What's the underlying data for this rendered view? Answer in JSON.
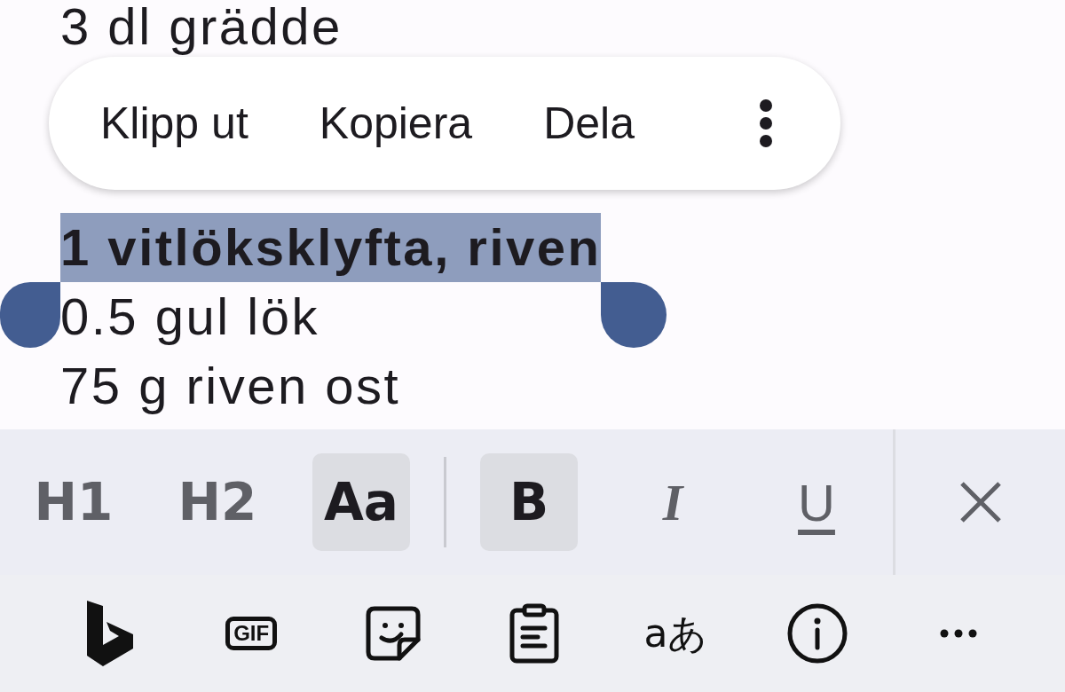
{
  "note": {
    "line_above_menu": "3 dl grädde",
    "lines": [
      {
        "text": "1 vitlöksklyfta, riven",
        "selected": true
      },
      {
        "text": "0.5 gul lök",
        "selected": false
      },
      {
        "text": "75 g riven ost",
        "selected": false
      }
    ]
  },
  "selection_menu": {
    "items": [
      "Klipp ut",
      "Kopiera",
      "Dela"
    ]
  },
  "format_toolbar": {
    "buttons": [
      {
        "kind": "h1",
        "label": "H1",
        "selected": false
      },
      {
        "kind": "h2",
        "label": "H2",
        "selected": false
      },
      {
        "kind": "text_size",
        "label": "Aa",
        "selected": true
      },
      {
        "kind": "bold",
        "label": "B",
        "selected": true
      },
      {
        "kind": "italic",
        "label": "I",
        "selected": false
      },
      {
        "kind": "underline",
        "label": "U",
        "selected": false
      }
    ]
  },
  "keyboard_toolbar": {
    "items": [
      {
        "kind": "bing"
      },
      {
        "kind": "gif",
        "label": "GIF"
      },
      {
        "kind": "sticker"
      },
      {
        "kind": "clipboard"
      },
      {
        "kind": "translate",
        "label": "aあ"
      },
      {
        "kind": "info"
      },
      {
        "kind": "more"
      }
    ]
  }
}
